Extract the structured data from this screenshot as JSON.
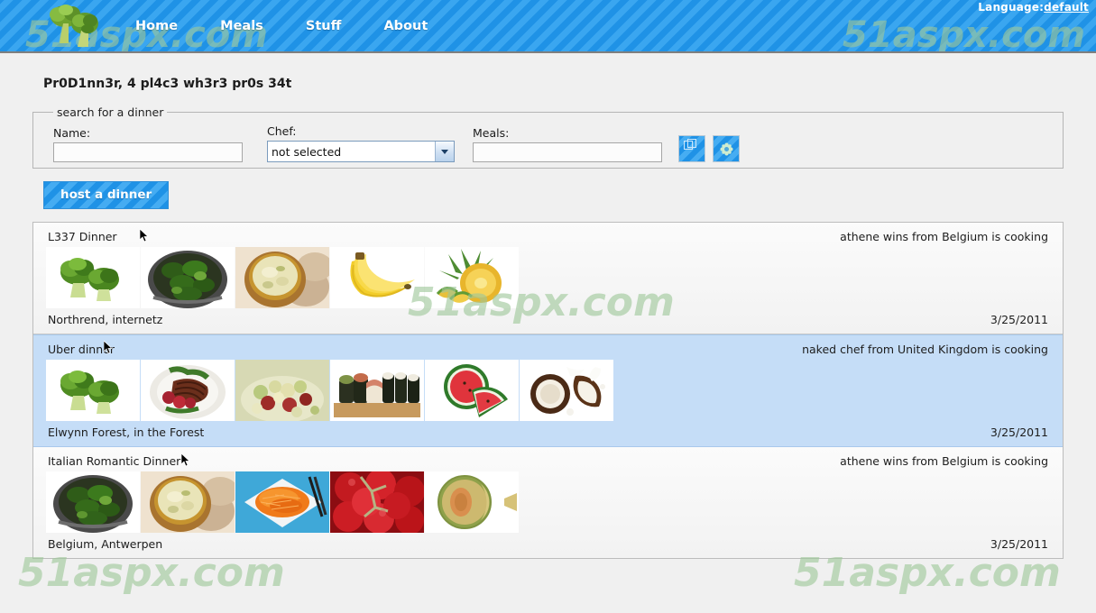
{
  "header": {
    "language_label": "Language:",
    "language_value": "default",
    "logo_alt": "broccoli-logo",
    "nav": [
      {
        "label": "Home"
      },
      {
        "label": "Meals"
      },
      {
        "label": "Stuff"
      },
      {
        "label": "About"
      }
    ]
  },
  "watermark": {
    "text": "51aspx.com",
    "color": "#9fc89a"
  },
  "main": {
    "page_title": "Pr0D1nn3r, 4 pl4c3 wh3r3 pr0s 34t",
    "search": {
      "legend": "search for a dinner",
      "name_label": "Name:",
      "name_value": "",
      "name_placeholder": "",
      "chef_label": "Chef:",
      "chef_selected": "not selected",
      "chef_options": [
        "not selected"
      ],
      "meals_label": "Meals:",
      "meals_value": "",
      "meals_placeholder": "",
      "copy_button_title": "copy",
      "settings_button_title": "settings"
    },
    "host_button": "host a dinner",
    "dinners": [
      {
        "title": "L337 Dinner",
        "cook": "athene wins from Belgium is cooking",
        "location": "Northrend, internetz",
        "date": "3/25/2011",
        "selected": false,
        "meals": [
          "broccoli",
          "broccoli-pot",
          "bread-bowl-soup",
          "bananas",
          "pineapple"
        ]
      },
      {
        "title": "Uber dinner",
        "cook": "naked chef from United Kingdom is cooking",
        "location": "Elwynn Forest, in the Forest",
        "date": "3/25/2011",
        "selected": true,
        "meals": [
          "broccoli",
          "steak-plate",
          "fruit-salad",
          "sushi",
          "watermelon",
          "coconut"
        ]
      },
      {
        "title": "Italian Romantic Dinner",
        "cook": "athene wins from Belgium is cooking",
        "location": "Belgium, Antwerpen",
        "date": "3/25/2011",
        "selected": false,
        "meals": [
          "broccoli-pot",
          "bread-bowl-soup",
          "shredded-carrots",
          "tomatoes",
          "melon"
        ]
      }
    ]
  },
  "colors": {
    "header_blue": "#2196e8",
    "selected_row": "#c5ddf7",
    "page_bg": "#f0f0f0"
  }
}
